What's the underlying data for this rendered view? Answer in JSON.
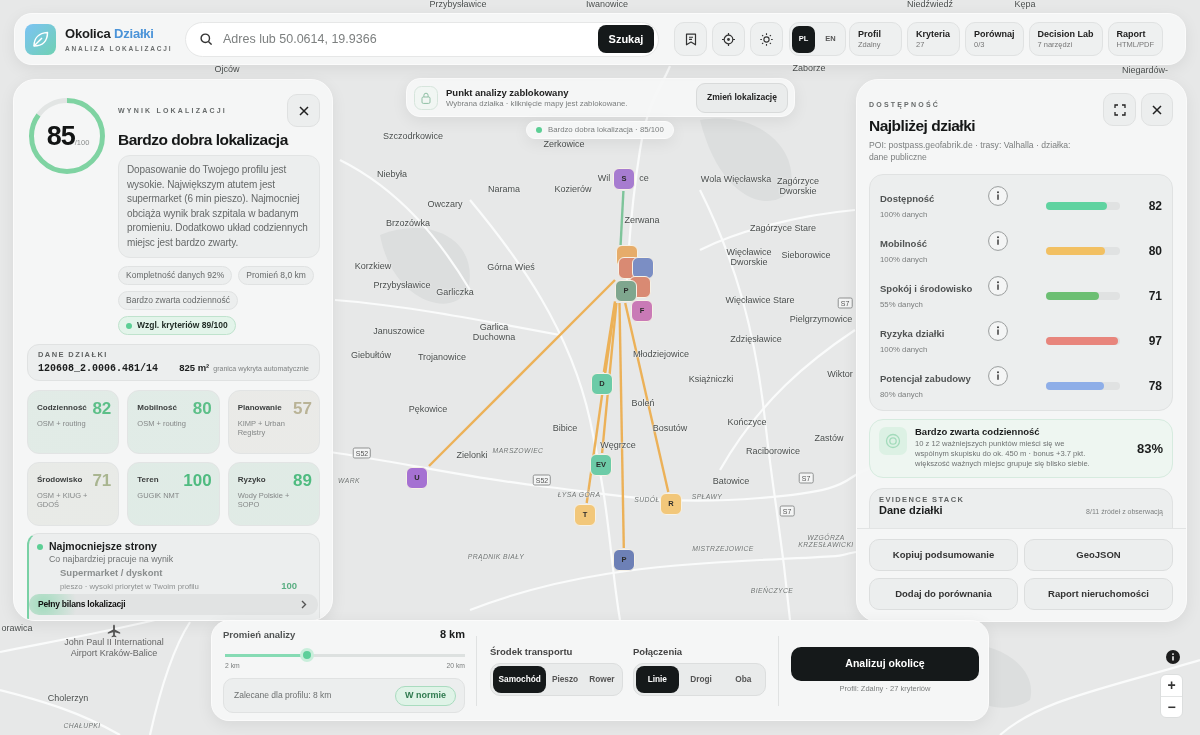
{
  "header": {
    "brand": {
      "name": "Okolica",
      "accent": "Działki",
      "tagline": "ANALIZA LOKALIZACJI"
    },
    "search": {
      "placeholder": "Adres lub 50.0614, 19.9366",
      "button": "Szukaj"
    },
    "languages": [
      {
        "label": "PL",
        "selected": true
      },
      {
        "label": "EN",
        "selected": false
      }
    ],
    "menu": [
      {
        "label": "Profil",
        "detail": "Zdalny"
      },
      {
        "label": "Kryteria",
        "detail": "27"
      },
      {
        "label": "Porównaj",
        "detail": "0/3"
      },
      {
        "label": "Decision Lab",
        "detail": "7 narzędzi"
      },
      {
        "label": "Raport",
        "detail": "HTML/PDF"
      }
    ]
  },
  "lock_banner": {
    "title": "Punkt analizy zablokowany",
    "text": "Wybrana działka · kliknięcie mapy jest zablokowane.",
    "button": "Zmień lokalizację"
  },
  "map_chip": {
    "text": "Bardzo dobra lokalizacja · 85/100"
  },
  "map": {
    "places": [
      {
        "name": "Przybysławice",
        "kind": "town"
      },
      {
        "name": "Iwanowice",
        "kind": "town"
      },
      {
        "name": "Niedźwiedź",
        "kind": "town"
      },
      {
        "name": "Kępa",
        "kind": "town"
      },
      {
        "name": "Ojców",
        "kind": "town"
      },
      {
        "name": "Zaborze",
        "kind": "town"
      },
      {
        "name": "Niegardów-",
        "kind": "town"
      },
      {
        "name": "Szczodrkowice",
        "kind": "town"
      },
      {
        "name": "Zerkowice",
        "kind": "town"
      },
      {
        "name": "Niebyła",
        "kind": "town"
      },
      {
        "name": "Narama",
        "kind": "town"
      },
      {
        "name": "Kozierów",
        "kind": "town"
      },
      {
        "name": "Wil",
        "kind": "town"
      },
      {
        "name": "ce",
        "kind": "town"
      },
      {
        "name": "Wola Więcławska",
        "kind": "town"
      },
      {
        "name": "Zagórzyce Dworskie",
        "kind": "town"
      },
      {
        "name": "Owczary",
        "kind": "town"
      },
      {
        "name": "Brzozówka",
        "kind": "town"
      },
      {
        "name": "Zerwana",
        "kind": "town"
      },
      {
        "name": "Zagórzyce Stare",
        "kind": "town"
      },
      {
        "name": "Korzkiew",
        "kind": "town"
      },
      {
        "name": "Górna Wieś",
        "kind": "town"
      },
      {
        "name": "Więcławice Dworskie",
        "kind": "town"
      },
      {
        "name": "Sieborowice",
        "kind": "town"
      },
      {
        "name": "Przybysławice",
        "kind": "town"
      },
      {
        "name": "Garliczka",
        "kind": "town"
      },
      {
        "name": "Więcławice Stare",
        "kind": "town"
      },
      {
        "name": "S7",
        "kind": "road"
      },
      {
        "name": "Pielgrzymowice",
        "kind": "town"
      },
      {
        "name": "Januszowice",
        "kind": "town"
      },
      {
        "name": "Garlica Duchowna",
        "kind": "town"
      },
      {
        "name": "Zdzięsławice",
        "kind": "town"
      },
      {
        "name": "Giebułtów",
        "kind": "town"
      },
      {
        "name": "Trojanowice",
        "kind": "town"
      },
      {
        "name": "Młodziejowice",
        "kind": "town"
      },
      {
        "name": "Książniczki",
        "kind": "town"
      },
      {
        "name": "Wiktor",
        "kind": "town"
      },
      {
        "name": "Pękowice",
        "kind": "town"
      },
      {
        "name": "Boleń",
        "kind": "town"
      },
      {
        "name": "Bibice",
        "kind": "town"
      },
      {
        "name": "Bosutów",
        "kind": "town"
      },
      {
        "name": "Kończyce",
        "kind": "town"
      },
      {
        "name": "S52",
        "kind": "road"
      },
      {
        "name": "Zielonki",
        "kind": "town"
      },
      {
        "name": "MARSZOWIEC",
        "kind": "district"
      },
      {
        "name": "Węgrzce",
        "kind": "town"
      },
      {
        "name": "Raciborowice",
        "kind": "town"
      },
      {
        "name": "Zastów",
        "kind": "town"
      },
      {
        "name": "WARK",
        "kind": "district"
      },
      {
        "name": "S52",
        "kind": "road"
      },
      {
        "name": "Batowice",
        "kind": "town"
      },
      {
        "name": "S7",
        "kind": "road"
      },
      {
        "name": "ŁYSA GÓRA",
        "kind": "district"
      },
      {
        "name": "SUDÓŁ",
        "kind": "district"
      },
      {
        "name": "SPŁAWY",
        "kind": "district"
      },
      {
        "name": "S7",
        "kind": "road"
      },
      {
        "name": "PRĄDNIK BIAŁY",
        "kind": "district"
      },
      {
        "name": "MISTRZEJOWICE",
        "kind": "district"
      },
      {
        "name": "WZGÓRZA KRZESŁAWICKI",
        "kind": "district"
      },
      {
        "name": "BIEŃCZYCE",
        "kind": "district"
      },
      {
        "name": "orawica",
        "kind": "town"
      },
      {
        "name": "Cholerzyn",
        "kind": "town"
      },
      {
        "name": "CHAŁUPKI",
        "kind": "district"
      }
    ],
    "airport": "John Paul II International Airport Kraków-Balice",
    "markers": [
      {
        "label": "S",
        "color": "#a77cd0",
        "connection": {
          "color": "#7ec49a"
        }
      },
      {
        "color": "#e6ac6a"
      },
      {
        "color": "#d98a73"
      },
      {
        "color": "#7b8ec4"
      },
      {
        "label": "P",
        "color": "#7fa68e"
      },
      {
        "color": "#d98a73"
      },
      {
        "label": "F",
        "color": "#c97ab6"
      },
      {
        "label": "D",
        "color": "#6ccba7",
        "connection": {
          "color": "#ecb158"
        }
      },
      {
        "label": "U",
        "color": "#a571d2",
        "connection": {
          "color": "#ecb158"
        }
      },
      {
        "label": "EV",
        "color": "#6ccba7",
        "connection": {
          "color": "#ecb158"
        }
      },
      {
        "label": "T",
        "color": "#f2c77a",
        "connection": {
          "color": "#ecb158"
        }
      },
      {
        "label": "R",
        "color": "#f2c77a",
        "connection": {
          "color": "#ecb158"
        }
      },
      {
        "label": "P",
        "color": "#6d80b6",
        "connection": {
          "color": "#ecb158"
        }
      }
    ],
    "zoom": [
      "+",
      "−"
    ]
  },
  "score_panel": {
    "label": "WYNIK LOKALIZACJI",
    "score": "85",
    "max": "/100",
    "level": 0.85,
    "title": "Bardzo dobra lokalizacja",
    "summary": "Dopasowanie do Twojego profilu jest wysokie. Największym atutem jest supermarket (6 min pieszo). Najmocniej obciąża wynik brak szpitala w badanym promieniu. Dodatkowo układ codziennych miejsc jest bardzo zwarty.",
    "chips": [
      {
        "text": "Kompletność danych 92%",
        "kind": "plain"
      },
      {
        "text": "Promień 8,0 km",
        "kind": "plain"
      },
      {
        "text": "Bardzo zwarta codzienność",
        "kind": "plain"
      },
      {
        "text": "Wzgl. kryteriów 89/100",
        "kind": "highlight"
      }
    ],
    "parcel": {
      "label": "DANE DZIAŁKI",
      "id": "120608_2.0006.481/14",
      "area": "825 m²",
      "note": "granica wykryta automatycznie"
    },
    "categories": [
      {
        "name": "Codzienność",
        "score": "82",
        "source": "OSM + routing",
        "color": "#5cbf88"
      },
      {
        "name": "Mobilność",
        "score": "80",
        "source": "OSM + routing",
        "color": "#5cbf88"
      },
      {
        "name": "Planowanie",
        "score": "57",
        "source": "KIMP + Urban Registry",
        "color": "#b9b396"
      },
      {
        "name": "Środowisko",
        "score": "71",
        "source": "OSM + KIUG + GDOŚ",
        "color": "#a9b590"
      },
      {
        "name": "Teren",
        "score": "100",
        "source": "GUGiK NMT",
        "color": "#4fbb80"
      },
      {
        "name": "Ryzyko",
        "score": "89",
        "source": "Wody Polskie + SOPO",
        "color": "#4fbb80"
      }
    ],
    "strengths": {
      "title": "Najmocniejsze strony",
      "subtitle": "Co najbardziej pracuje na wynik",
      "items": [
        {
          "name": "Supermarket / dyskont",
          "detail": "pieszo · wysoki priorytet w Twoim profilu",
          "score": "100"
        }
      ]
    },
    "footer_button": "Pełny bilans lokalizacji"
  },
  "access_panel": {
    "label": "DOSTĘPNOŚĆ",
    "title": "Najbliżej działki",
    "source": "POI: postpass.geofabrik.de · trasy: Valhalla · działka: dane publiczne",
    "metrics": [
      {
        "name": "Dostępność",
        "coverage": "100% danych",
        "value": "82",
        "level": 0.82,
        "color": "#5fd3a0"
      },
      {
        "name": "Mobilność",
        "coverage": "100% danych",
        "value": "80",
        "level": 0.8,
        "color": "#f2c062"
      },
      {
        "name": "Spokój i środowisko",
        "coverage": "55% danych",
        "value": "71",
        "level": 0.71,
        "color": "#6cbf73"
      },
      {
        "name": "Ryzyka działki",
        "coverage": "100% danych",
        "value": "97",
        "level": 0.97,
        "color": "#e8857c"
      },
      {
        "name": "Potencjał zabudowy",
        "coverage": "80% danych",
        "value": "78",
        "level": 0.78,
        "color": "#8eaee8"
      }
    ],
    "cluster": {
      "title": "Bardzo zwarta codzienność",
      "text": "10 z 12 ważniejszych punktów mieści się we wspólnym skupisku do ok. 450 m · bonus +3.7 pkt. większość ważnych miejsc grupuje się blisko siebie.",
      "value": "83%"
    },
    "evidence": {
      "label": "EVIDENCE STACK",
      "title": "Dane działki",
      "note": "8/11 źródeł z obserwacją"
    },
    "actions": [
      "Kopiuj podsumowanie",
      "GeoJSON",
      "Dodaj do porównania",
      "Raport nieruchomości"
    ]
  },
  "controls": {
    "radius": {
      "label": "Promień analizy",
      "value": "8 km",
      "level": 0.34,
      "min": "2 km",
      "max": "20 km",
      "recommendation": "Zalecane dla profilu: 8 km",
      "status": "W normie"
    },
    "transport": {
      "label": "Środek transportu",
      "options": [
        {
          "label": "Samochód",
          "selected": true
        },
        {
          "label": "Pieszo",
          "selected": false
        },
        {
          "label": "Rower",
          "selected": false
        }
      ]
    },
    "connections": {
      "label": "Połączenia",
      "options": [
        {
          "label": "Linie",
          "selected": true
        },
        {
          "label": "Drogi",
          "selected": false
        },
        {
          "label": "Oba",
          "selected": false
        }
      ]
    },
    "analyze": {
      "button": "Analizuj okolicę",
      "note": "Profil: Zdalny · 27 kryteriów"
    }
  }
}
